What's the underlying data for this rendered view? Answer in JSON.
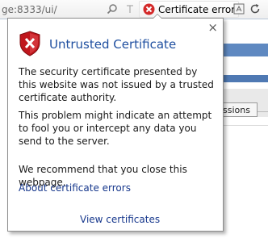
{
  "address_bar": {
    "url_text": "ge:8333/ui/",
    "cert_error_label": "Certificate error",
    "colors": {
      "error_red": "#d42a2a",
      "border": "#b9c7d9"
    },
    "icons": [
      "search-icon",
      "separator-icon",
      "error-x-icon",
      "compatibility-view-icon",
      "refresh-icon"
    ]
  },
  "background_page": {
    "tab_fragment": "ssions"
  },
  "popup": {
    "title": "Untrusted Certificate",
    "paragraph_1": "The security certificate presented by this website was not issued by a trusted certificate authority.",
    "paragraph_2": "This problem might indicate an attempt to fool you or intercept any data you send to the server.",
    "recommendation": "We recommend that you close this webpage.",
    "about_link": "About certificate errors",
    "view_link": "View certificates",
    "close_glyph": "×",
    "icon": "shield-error-icon",
    "colors": {
      "title": "#1f4fa0",
      "link": "#16378c",
      "shield_red": "#c0161c"
    }
  }
}
